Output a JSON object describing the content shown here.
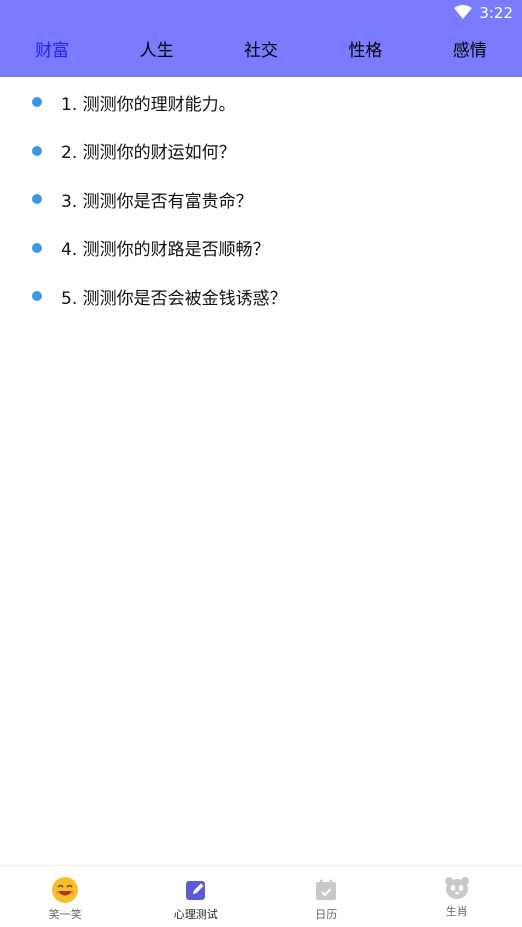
{
  "status_bar": {
    "time": "3:22",
    "icons": [
      "wifi-icon"
    ]
  },
  "tabs": [
    {
      "label": "财富",
      "active": true
    },
    {
      "label": "人生",
      "active": false
    },
    {
      "label": "社交",
      "active": false
    },
    {
      "label": "性格",
      "active": false
    },
    {
      "label": "感情",
      "active": false
    }
  ],
  "list_items": [
    {
      "text": "1. 测测你的理财能力。"
    },
    {
      "text": "2. 测测你的财运如何？"
    },
    {
      "text": "3. 测测你是否有富贵命？"
    },
    {
      "text": "4. 测测你的财路是否顺畅？"
    },
    {
      "text": "5. 测测你是否会被金钱诱惑？"
    }
  ],
  "bottom_nav": [
    {
      "label": "笑一笑",
      "icon": "smiley-icon",
      "active": false
    },
    {
      "label": "心理测试",
      "icon": "edit-icon",
      "active": true
    },
    {
      "label": "日历",
      "icon": "calendar-icon",
      "active": false
    },
    {
      "label": "生肖",
      "icon": "panda-icon",
      "active": false
    }
  ],
  "colors": {
    "header_bg": "#7b7bff",
    "active_tab": "#2222ee",
    "bullet": "#3d97e0",
    "nav_active_icon": "#5b5bd6",
    "nav_inactive_icon": "#c8c8c8"
  }
}
